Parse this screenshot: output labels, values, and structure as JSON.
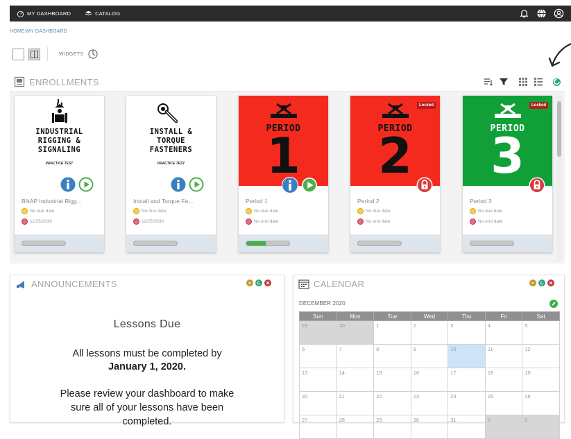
{
  "topbar": {
    "nav": [
      {
        "label": "MY DASHBOARD",
        "icon": "dashboard-icon"
      },
      {
        "label": "CATALOG",
        "icon": "catalog-icon"
      }
    ],
    "right_icons": [
      "bell-icon",
      "globe-icon",
      "user-circle-icon"
    ]
  },
  "breadcrumb": {
    "home": "HOME",
    "separator": "/",
    "current": "MY DASHBOARD"
  },
  "toolbar": {
    "widgets_label": "WIDGETS"
  },
  "enrollments": {
    "title": "ENROLLMENTS",
    "cards": [
      {
        "cover": "white",
        "cover_title": [
          "INDUSTRIAL",
          "RIGGING &",
          "SIGNALING"
        ],
        "cover_sub": "PRACTICE TEST",
        "name": "BNAP Industrial Rigg...",
        "due": "No due date",
        "date": "11/25/2030",
        "progress": 0,
        "actions": [
          "info",
          "play"
        ]
      },
      {
        "cover": "white",
        "cover_title": [
          "INSTALL &",
          "TORQUE",
          "FASTENERS"
        ],
        "cover_sub": "PRACTICE TEST",
        "name": "Install and Torque Fa...",
        "due": "No due date",
        "date": "11/25/2030",
        "progress": 0,
        "actions": [
          "info",
          "play"
        ]
      },
      {
        "cover": "red",
        "period_label": "PERIOD",
        "period_number": "1",
        "name": "Period 1",
        "due": "No due date",
        "date": "No end date",
        "progress": 0.45,
        "actions": [
          "info",
          "play"
        ]
      },
      {
        "cover": "red",
        "period_label": "PERIOD",
        "period_number": "2",
        "locked_label": "Locked",
        "name": "Period 2",
        "due": "No due date",
        "date": "No end date",
        "progress": 0,
        "actions": [
          "lock"
        ]
      },
      {
        "cover": "green",
        "period_label": "PERIOD",
        "period_number": "3",
        "locked_label": "Locked",
        "name": "Period 3",
        "due": "No due date",
        "date": "No end date",
        "progress": 0,
        "actions": [
          "lock"
        ]
      }
    ]
  },
  "announcements": {
    "title": "ANNOUNCEMENTS",
    "heading": "Lessons Due",
    "p1_line1": "All lessons must be completed by",
    "p1_line2": "January 1, 2020.",
    "p2_line1": "Please review your dashboard to make",
    "p2_line2": "sure all of your lessons have been",
    "p2_line3": "completed."
  },
  "calendar": {
    "title": "CALENDAR",
    "month": "DECEMBER 2020",
    "days": [
      "Sun",
      "Mon",
      "Tue",
      "Wed",
      "Thu",
      "Fri",
      "Sat"
    ],
    "weeks": [
      [
        {
          "d": "29",
          "o": true
        },
        {
          "d": "30",
          "o": true
        },
        {
          "d": "1"
        },
        {
          "d": "2"
        },
        {
          "d": "3"
        },
        {
          "d": "4"
        },
        {
          "d": "5"
        }
      ],
      [
        {
          "d": "6"
        },
        {
          "d": "7"
        },
        {
          "d": "8"
        },
        {
          "d": "9"
        },
        {
          "d": "10",
          "t": true
        },
        {
          "d": "11"
        },
        {
          "d": "12"
        }
      ],
      [
        {
          "d": "13"
        },
        {
          "d": "14"
        },
        {
          "d": "15"
        },
        {
          "d": "16"
        },
        {
          "d": "17"
        },
        {
          "d": "18"
        },
        {
          "d": "19"
        }
      ],
      [
        {
          "d": "20"
        },
        {
          "d": "21"
        },
        {
          "d": "22"
        },
        {
          "d": "23"
        },
        {
          "d": "24"
        },
        {
          "d": "25"
        },
        {
          "d": "26"
        }
      ],
      [
        {
          "d": "27"
        },
        {
          "d": "28"
        },
        {
          "d": "29"
        },
        {
          "d": "30"
        },
        {
          "d": "31"
        },
        {
          "d": "1",
          "o": true
        },
        {
          "d": "2",
          "o": true
        }
      ]
    ]
  },
  "colors": {
    "red_cover": "#f52a1f",
    "green_cover": "#11a038",
    "topbar": "#2b2b2b",
    "info_blue": "#3a7fc1",
    "play_green": "#4bae4f"
  }
}
